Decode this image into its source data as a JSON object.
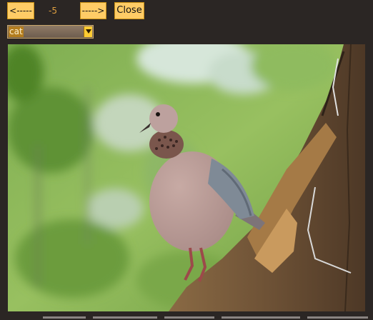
{
  "toolbar": {
    "prev_label": "<-----",
    "counter": "-5",
    "next_label": "----->",
    "close_label": "Close"
  },
  "category_select": {
    "value": "cat",
    "arrow_icon": "chevron-down-icon"
  },
  "photo": {
    "subject_icon": "dove-on-branch-photo"
  },
  "colors": {
    "background": "#2b2624",
    "button": "#ffcc66",
    "counter_text": "#e0a040",
    "select_highlight": "#b37d1f"
  }
}
